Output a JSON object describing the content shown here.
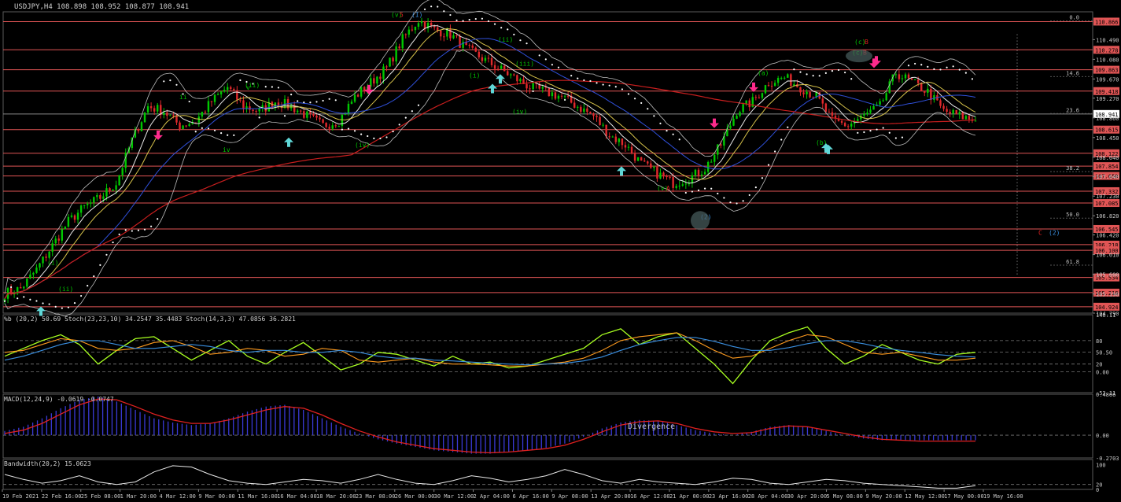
{
  "header": {
    "symbol_line": "USDJPY,H4  108.898 108.952 108.877 108.941"
  },
  "colors": {
    "background": "#000000",
    "up_candle": "#00c800",
    "down_candle": "#e0292c",
    "h_line": "#e05555",
    "ma_fast": "#e8e8e8",
    "ma_yellow": "#d6c24a",
    "ma_blue": "#2f4fd8",
    "ma_red": "#c81e1e",
    "bollinger": "#bdbdbd",
    "psar": "#ffffff",
    "price_label_bg": "#e05555",
    "cyan_arrow": "#5fd7d7",
    "pink_arrow": "#ff2a8c",
    "stoch_green": "#a8ff20",
    "stoch_orange": "#ff9b1e",
    "stoch_blue": "#3a8fe0",
    "macd_hist": "#3a3ad6",
    "macd_signal": "#e02020",
    "bandwidth": "#e8e8e8"
  },
  "chart_data": [
    {
      "type": "candlestick",
      "panel": "price",
      "title": "USDJPY,H4",
      "ohlc": {
        "open": 108.898,
        "high": 108.952,
        "low": 108.877,
        "close": 108.941
      },
      "ylim": [
        104.79,
        111.07
      ],
      "x_labels": [
        "19 Feb 2021",
        "22 Feb 16:00",
        "25 Feb 08:00",
        "1 Mar 20:00",
        "4 Mar 12:00",
        "9 Mar 00:00",
        "11 Mar 16:00",
        "16 Mar 04:00",
        "18 Mar 20:00",
        "23 Mar 08:00",
        "26 Mar 00:00",
        "30 Mar 12:00",
        "2 Apr 04:00",
        "6 Apr 16:00",
        "9 Apr 08:00",
        "13 Apr 20:00",
        "16 Apr 12:00",
        "21 Apr 00:00",
        "23 Apr 16:00",
        "28 Apr 04:00",
        "30 Apr 20:00",
        "5 May 08:00",
        "9 May 20:00",
        "12 May 12:00",
        "17 May 00:00",
        "19 May 16:00"
      ],
      "y_ticks": [
        110.49,
        110.08,
        109.67,
        109.27,
        108.86,
        108.45,
        108.04,
        107.64,
        107.23,
        106.82,
        106.42,
        106.01,
        105.6,
        105.19,
        104.79
      ],
      "price_labels": [
        "110.866",
        "110.278",
        "109.863",
        "109.418",
        "108.941",
        "108.615",
        "108.122",
        "107.854",
        "107.650",
        "107.332",
        "107.085",
        "106.545",
        "106.218",
        "106.100",
        "105.534",
        "105.218",
        "104.924"
      ],
      "fib_labels": [
        {
          "text": "0.0",
          "price": 110.88
        },
        {
          "text": "14.6",
          "price": 109.72
        },
        {
          "text": "23.6",
          "price": 108.95
        },
        {
          "text": "38.2",
          "price": 107.74
        },
        {
          "text": "50.0",
          "price": 106.77
        },
        {
          "text": "61.8",
          "price": 105.79
        }
      ],
      "series": [
        {
          "name": "close",
          "values": [
            105.2,
            105.3,
            105.7,
            106.2,
            106.7,
            107.0,
            107.2,
            107.5,
            108.4,
            109.1,
            109.0,
            108.7,
            108.8,
            109.2,
            109.5,
            109.1,
            109.0,
            109.2,
            109.1,
            108.9,
            108.7,
            108.8,
            109.3,
            109.6,
            109.9,
            110.5,
            110.9,
            110.7,
            110.6,
            110.3,
            110.1,
            109.9,
            109.7,
            109.5,
            109.4,
            109.3,
            109.1,
            108.9,
            108.5,
            108.3,
            107.9,
            107.7,
            107.5,
            107.6,
            107.8,
            108.3,
            109.0,
            109.2,
            109.6,
            109.7,
            109.5,
            109.3,
            108.8,
            108.7,
            108.9,
            109.1,
            109.8,
            109.6,
            109.4,
            109.0,
            108.9,
            108.8
          ]
        }
      ],
      "wave_labels": [
        {
          "text": "(v)",
          "price": 110.96,
          "color": "#00c800"
        },
        {
          "text": "5",
          "price": 110.96,
          "color": "#e02020"
        },
        {
          "text": "(I)",
          "price": 110.96,
          "color": "#3a8fe0"
        },
        {
          "text": "(ii)",
          "price": 110.45,
          "color": "#00c800"
        },
        {
          "text": "(iii)",
          "price": 109.95,
          "color": "#00c800"
        },
        {
          "text": "(i)",
          "price": 109.7,
          "color": "#00c800"
        },
        {
          "text": "(iv)",
          "price": 108.95,
          "color": "#00c800"
        },
        {
          "text": "ii",
          "price": 109.25,
          "color": "#00c800"
        },
        {
          "text": "(ii)",
          "price": 109.5,
          "color": "#00c800"
        },
        {
          "text": "v",
          "price": 109.45,
          "color": "#00c800"
        },
        {
          "text": "(iv)",
          "price": 108.25,
          "color": "#00c800"
        },
        {
          "text": "iv",
          "price": 108.15,
          "color": "#00c800"
        },
        {
          "text": "(v)",
          "price": 107.35,
          "color": "#00c800"
        },
        {
          "text": "A",
          "price": 107.35,
          "color": "#e02020"
        },
        {
          "text": "(2)",
          "price": 106.75,
          "color": "#3a8fe0"
        },
        {
          "text": "(a)",
          "price": 109.75,
          "color": "#00c800"
        },
        {
          "text": "(b)",
          "price": 108.3,
          "color": "#00c800"
        },
        {
          "text": "(c)",
          "price": 110.18,
          "color": "#00c800"
        },
        {
          "text": "B",
          "price": 110.18,
          "color": "#e02020"
        },
        {
          "text": "(c)",
          "price": 110.4,
          "color": "#00c800"
        },
        {
          "text": "B",
          "price": 110.4,
          "color": "#e02020"
        },
        {
          "text": "C",
          "price": 106.42,
          "color": "#e02020"
        },
        {
          "text": "(2)",
          "price": 106.42,
          "color": "#3a8fe0"
        },
        {
          "text": "(i)",
          "price": 105.8,
          "color": "#00c800"
        },
        {
          "text": "(ii)",
          "price": 105.25,
          "color": "#00c800"
        }
      ]
    },
    {
      "type": "line",
      "panel": "stochastic",
      "title": "%b (20,2) 50.69  Stoch(23,23,10) 34.2547 35.4483  Stoch(14,3,3) 47.0856 36.2821",
      "ylim": [
        -53.11,
        146.11
      ],
      "y_ticks": [
        146.11,
        80,
        50.5,
        0.0,
        20,
        -53.11
      ],
      "y_tick_labels": [
        "146.11",
        "80",
        "50.50",
        "0.00",
        "20",
        "-53.11"
      ],
      "series": [
        {
          "name": "%b",
          "values": [
            40,
            60,
            80,
            95,
            70,
            20,
            55,
            85,
            90,
            60,
            30,
            55,
            80,
            40,
            20,
            50,
            75,
            40,
            5,
            20,
            50,
            45,
            30,
            15,
            40,
            20,
            25,
            10,
            15,
            30,
            45,
            60,
            95,
            110,
            70,
            90,
            100,
            60,
            20,
            -30,
            30,
            80,
            100,
            115,
            60,
            20,
            40,
            70,
            50,
            30,
            20,
            45,
            50
          ]
        },
        {
          "name": "stoch_slow",
          "values": [
            50,
            55,
            70,
            85,
            80,
            60,
            55,
            60,
            75,
            80,
            65,
            45,
            50,
            60,
            55,
            40,
            45,
            60,
            55,
            30,
            25,
            30,
            35,
            25,
            20,
            20,
            18,
            15,
            15,
            20,
            25,
            35,
            55,
            80,
            90,
            95,
            100,
            80,
            55,
            35,
            40,
            60,
            80,
            95,
            90,
            70,
            50,
            45,
            50,
            40,
            30,
            30,
            35
          ]
        },
        {
          "name": "stoch_blue",
          "values": [
            30,
            40,
            55,
            70,
            80,
            80,
            70,
            60,
            60,
            65,
            70,
            65,
            55,
            50,
            55,
            55,
            50,
            50,
            55,
            50,
            40,
            35,
            35,
            30,
            28,
            25,
            22,
            20,
            18,
            20,
            22,
            28,
            38,
            55,
            70,
            80,
            88,
            88,
            78,
            65,
            55,
            55,
            62,
            72,
            80,
            80,
            72,
            62,
            55,
            50,
            44,
            40,
            38
          ]
        }
      ]
    },
    {
      "type": "bar",
      "panel": "macd",
      "title": "MACD(12,24,9) -0.0619 -0.0747",
      "annotation": "Divergence",
      "ylim": [
        -0.2703,
        0.4866
      ],
      "y_ticks": [
        0.4866,
        0.0,
        -0.2703
      ],
      "y_tick_labels": [
        "0.4866",
        "0.00",
        "-0.2703"
      ],
      "series": [
        {
          "name": "histogram",
          "values": [
            0.05,
            0.1,
            0.2,
            0.32,
            0.42,
            0.46,
            0.4,
            0.3,
            0.2,
            0.15,
            0.12,
            0.14,
            0.2,
            0.28,
            0.34,
            0.36,
            0.3,
            0.2,
            0.1,
            0.02,
            -0.05,
            -0.1,
            -0.14,
            -0.18,
            -0.2,
            -0.22,
            -0.22,
            -0.2,
            -0.18,
            -0.15,
            -0.1,
            -0.02,
            0.08,
            0.15,
            0.18,
            0.17,
            0.12,
            0.06,
            0.02,
            0.0,
            0.04,
            0.1,
            0.12,
            0.1,
            0.05,
            0.0,
            -0.04,
            -0.06,
            -0.06,
            -0.06,
            -0.06,
            -0.06,
            -0.06
          ]
        },
        {
          "name": "signal",
          "values": [
            0.02,
            0.06,
            0.14,
            0.25,
            0.36,
            0.43,
            0.42,
            0.34,
            0.25,
            0.18,
            0.14,
            0.14,
            0.18,
            0.24,
            0.3,
            0.34,
            0.32,
            0.24,
            0.14,
            0.05,
            -0.02,
            -0.08,
            -0.12,
            -0.16,
            -0.18,
            -0.2,
            -0.21,
            -0.2,
            -0.18,
            -0.16,
            -0.12,
            -0.05,
            0.04,
            0.12,
            0.16,
            0.17,
            0.14,
            0.08,
            0.04,
            0.02,
            0.03,
            0.08,
            0.11,
            0.1,
            0.06,
            0.02,
            -0.02,
            -0.05,
            -0.06,
            -0.07,
            -0.07,
            -0.07,
            -0.07
          ]
        }
      ]
    },
    {
      "type": "line",
      "panel": "bandwidth",
      "title": "Bandwidth(20,2) 15.0623",
      "ylim": [
        0,
        120
      ],
      "y_ticks": [
        100,
        20,
        0
      ],
      "y_tick_labels": [
        "100",
        "20",
        "0"
      ],
      "series": [
        {
          "name": "bandwidth",
          "values": [
            60,
            40,
            25,
            35,
            55,
            30,
            20,
            30,
            70,
            95,
            90,
            60,
            35,
            25,
            20,
            30,
            40,
            35,
            25,
            40,
            60,
            40,
            25,
            20,
            35,
            55,
            45,
            30,
            40,
            55,
            80,
            60,
            35,
            25,
            40,
            30,
            25,
            20,
            30,
            45,
            40,
            25,
            20,
            30,
            40,
            35,
            25,
            20,
            15,
            10,
            5,
            5,
            15
          ]
        }
      ]
    }
  ]
}
